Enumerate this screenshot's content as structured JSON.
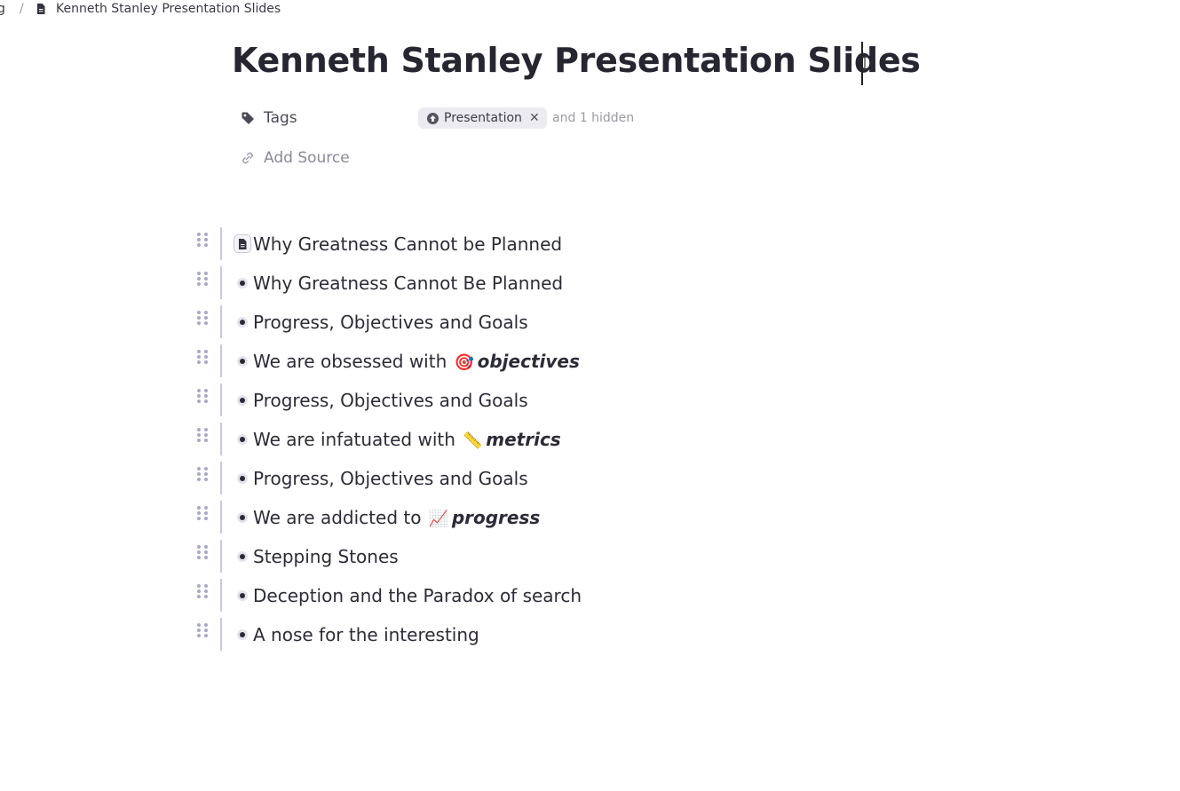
{
  "breadcrumb": {
    "previous": "g",
    "separator": "/",
    "current": "Kenneth Stanley Presentation Slides",
    "icon": "document-icon"
  },
  "page": {
    "title": "Kenneth Stanley Presentation Slides"
  },
  "properties": {
    "tags_label": "Tags",
    "tags": [
      {
        "label": "Presentation",
        "icon": "tag-up-arrow-icon"
      }
    ],
    "hidden_tags": "and 1 hidden",
    "add_source_label": "Add Source"
  },
  "outline": {
    "items": [
      {
        "type": "document",
        "text": "Why Greatness Cannot be Planned"
      },
      {
        "type": "bullet",
        "text": "Why Greatness Cannot Be Planned"
      },
      {
        "type": "bullet",
        "text": "Progress, Objectives and Goals"
      },
      {
        "type": "bullet",
        "text": "We are obsessed with ",
        "emoji": "🎯",
        "emphasis": "objectives"
      },
      {
        "type": "bullet",
        "text": "Progress, Objectives and Goals"
      },
      {
        "type": "bullet",
        "text": "We are infatuated with ",
        "emoji": "📏",
        "emphasis": "metrics"
      },
      {
        "type": "bullet",
        "text": "Progress, Objectives and Goals"
      },
      {
        "type": "bullet",
        "text": "We are addicted to ",
        "emoji": "📈",
        "emphasis": "progress"
      },
      {
        "type": "bullet",
        "text": "Stepping Stones"
      },
      {
        "type": "bullet",
        "text": "Deception and the Paradox of search"
      },
      {
        "type": "bullet",
        "text": "A nose for the interesting"
      }
    ]
  },
  "colors": {
    "rail": "#c8c9e6",
    "handle": "#a9a9c6",
    "tag_chip_bg": "#ecebf1",
    "text": "#2c2c38"
  }
}
